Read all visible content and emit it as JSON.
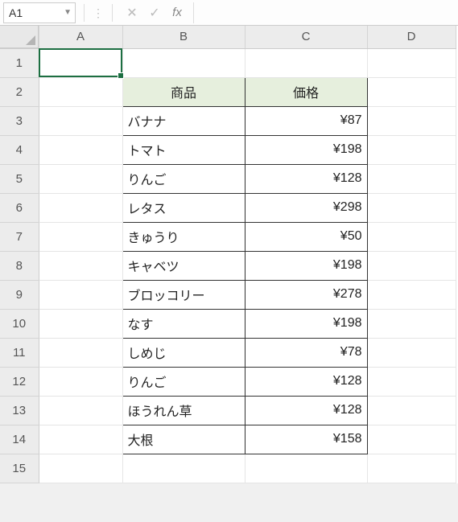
{
  "namebox": "A1",
  "fx_label": "fx",
  "columns": [
    "A",
    "B",
    "C",
    "D"
  ],
  "rows": [
    "1",
    "2",
    "3",
    "4",
    "5",
    "6",
    "7",
    "8",
    "9",
    "10",
    "11",
    "12",
    "13",
    "14",
    "15"
  ],
  "table": {
    "header": {
      "product": "商品",
      "price": "価格"
    },
    "items": [
      {
        "product": "バナナ",
        "price": "¥87"
      },
      {
        "product": "トマト",
        "price": "¥198"
      },
      {
        "product": "りんご",
        "price": "¥128"
      },
      {
        "product": "レタス",
        "price": "¥298"
      },
      {
        "product": "きゅうり",
        "price": "¥50"
      },
      {
        "product": "キャベツ",
        "price": "¥198"
      },
      {
        "product": "ブロッコリー",
        "price": "¥278"
      },
      {
        "product": "なす",
        "price": "¥198"
      },
      {
        "product": "しめじ",
        "price": "¥78"
      },
      {
        "product": "りんご",
        "price": "¥128"
      },
      {
        "product": "ほうれん草",
        "price": "¥128"
      },
      {
        "product": "大根",
        "price": "¥158"
      }
    ]
  },
  "chart_data": {
    "type": "table",
    "title": "",
    "columns": [
      "商品",
      "価格"
    ],
    "rows": [
      [
        "バナナ",
        87
      ],
      [
        "トマト",
        198
      ],
      [
        "りんご",
        128
      ],
      [
        "レタス",
        298
      ],
      [
        "きゅうり",
        50
      ],
      [
        "キャベツ",
        198
      ],
      [
        "ブロッコリー",
        278
      ],
      [
        "なす",
        198
      ],
      [
        "しめじ",
        78
      ],
      [
        "りんご",
        128
      ],
      [
        "ほうれん草",
        128
      ],
      [
        "大根",
        158
      ]
    ]
  }
}
